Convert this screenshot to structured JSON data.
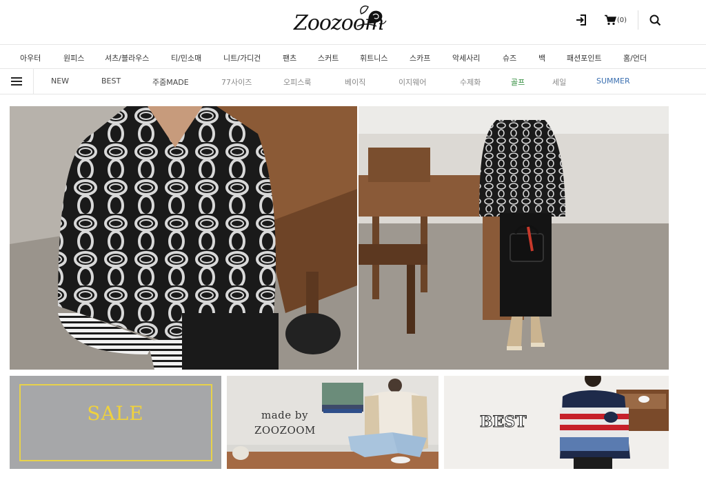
{
  "header": {
    "logo_text": "Zoozoom",
    "cart_count": "(0)"
  },
  "categories": [
    "아우터",
    "원피스",
    "셔츠/블라우스",
    "티/민소매",
    "니트/가디건",
    "팬츠",
    "스커트",
    "휘트니스",
    "스카프",
    "악세사리",
    "슈즈",
    "백",
    "패션포인트",
    "홈/언더"
  ],
  "subnav": {
    "items": [
      {
        "label": "NEW",
        "color": "#444444"
      },
      {
        "label": "BEST",
        "color": "#444444"
      },
      {
        "label": "주줌MADE",
        "color": "#444444"
      },
      {
        "label": "77사이즈",
        "color": "#888888"
      },
      {
        "label": "오피스룩",
        "color": "#888888"
      },
      {
        "label": "베이직",
        "color": "#888888"
      },
      {
        "label": "이지웨어",
        "color": "#888888"
      },
      {
        "label": "수제화",
        "color": "#888888"
      },
      {
        "label": "골프",
        "color": "#2e8b3a"
      },
      {
        "label": "세일",
        "color": "#888888"
      },
      {
        "label": "SUMMER",
        "color": "#3a6fb0"
      }
    ]
  },
  "tiles": {
    "sale_label": "SALE",
    "made_line1": "made by",
    "made_line2": "ZOOZOOM",
    "best_label": "BEST"
  },
  "colors": {
    "sale_bg": "#a6a7a9",
    "sale_accent": "#f0d23c",
    "golf": "#2e8b3a",
    "summer": "#3a6fb0"
  }
}
